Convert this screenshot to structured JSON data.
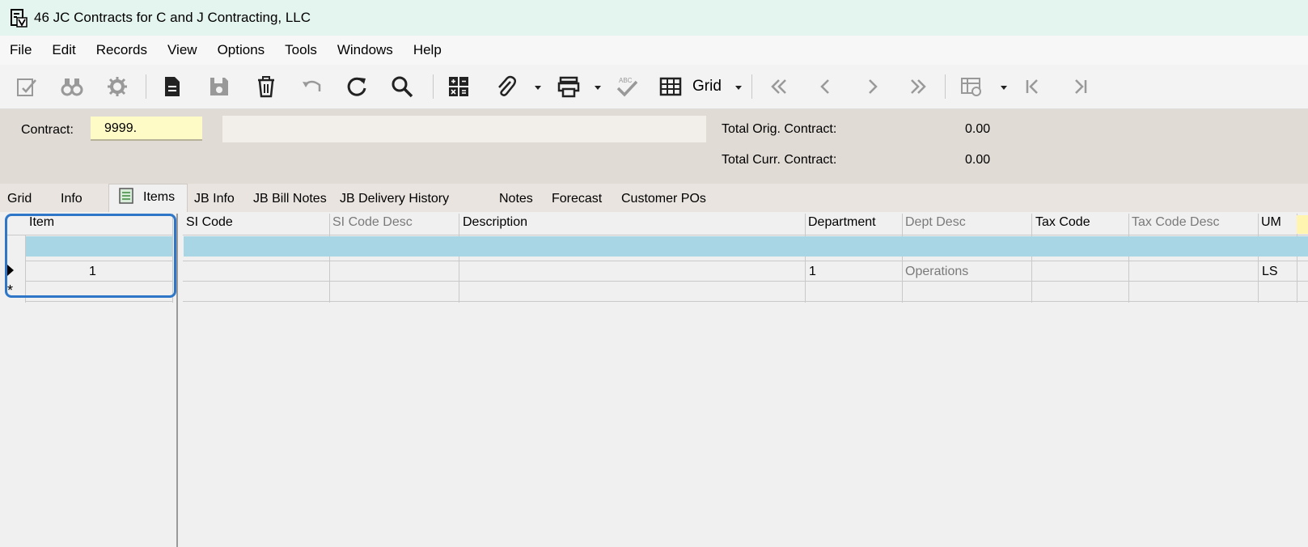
{
  "window": {
    "title": "46 JC Contracts for C and J Contracting, LLC",
    "app_icon": "document-v-icon"
  },
  "menu": [
    "File",
    "Edit",
    "Records",
    "View",
    "Options",
    "Tools",
    "Windows",
    "Help"
  ],
  "toolbar": {
    "grid_label": "Grid",
    "icons": [
      "edit-icon",
      "binoculars-icon",
      "gear-icon",
      "new-document-icon",
      "save-icon",
      "delete-icon",
      "undo-icon",
      "refresh-icon",
      "search-icon",
      "calculator-icon",
      "attach-icon",
      "print-icon",
      "spellcheck-icon",
      "grid-icon",
      "first-icon",
      "previous-icon",
      "next-icon",
      "last-icon",
      "table-settings-icon",
      "first-record-icon",
      "last-record-icon"
    ]
  },
  "header": {
    "contract_label": "Contract:",
    "contract_value": "9999.",
    "contract_desc": "",
    "total_orig_label": "Total Orig. Contract:",
    "total_orig_value": "0.00",
    "total_curr_label": "Total Curr. Contract:",
    "total_curr_value": "0.00"
  },
  "tabs": [
    "Grid",
    "Info",
    "Items",
    "JB Info",
    "JB Bill Notes",
    "JB Delivery History",
    "Notes",
    "Forecast",
    "Customer POs"
  ],
  "active_tab": "Items",
  "grid": {
    "columns": [
      "Item",
      "SI Code",
      "SI Code Desc",
      "Description",
      "Department",
      "Dept Desc",
      "Tax Code",
      "Tax Code Desc",
      "UM"
    ],
    "rows": [
      {
        "item": "1",
        "si_code": "",
        "si_code_desc": "",
        "description": "",
        "department": "1",
        "dept_desc": "Operations",
        "tax_code": "",
        "tax_code_desc": "",
        "um": "LS"
      }
    ],
    "new_row_marker": "*"
  },
  "colors": {
    "titlebar": "#e4f4ee",
    "filter_row": "#a9d6e4",
    "contract_input": "#fffbc6",
    "highlight": "#2e77c8"
  }
}
